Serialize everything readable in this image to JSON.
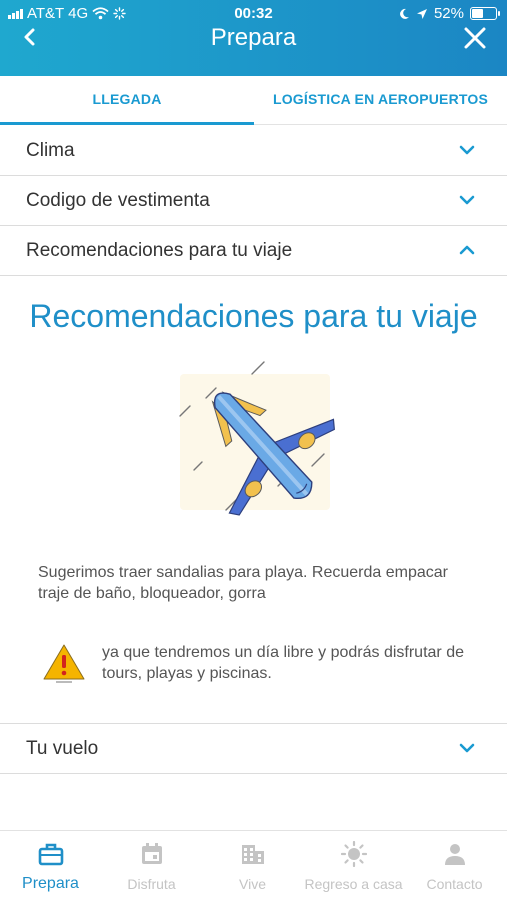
{
  "status_bar": {
    "carrier": "AT&T 4G",
    "time": "00:32",
    "battery": "52%",
    "battery_level": 0.52
  },
  "header": {
    "title": "Prepara"
  },
  "tabs": [
    {
      "label": "LLEGADA",
      "active": true
    },
    {
      "label": "LOGÍSTICA EN AEROPUERTOS",
      "active": false
    }
  ],
  "accordion": {
    "clima": "Clima",
    "vestimenta": "Codigo de vestimenta",
    "recomendaciones": "Recomendaciones para tu viaje",
    "vuelo": "Tu vuelo"
  },
  "section": {
    "title": "Recomendaciones para tu viaje",
    "paragraph": "Sugerimos traer sandalias para playa. Recuerda empacar traje de baño, bloqueador, gorra",
    "warning": "ya que tendremos un día libre y podrás disfrutar de tours, playas y piscinas."
  },
  "bottom_nav": [
    {
      "label": "Prepara",
      "icon": "briefcase-icon",
      "active": true
    },
    {
      "label": "Disfruta",
      "icon": "calendar-icon",
      "active": false
    },
    {
      "label": "Vive",
      "icon": "building-icon",
      "active": false
    },
    {
      "label": "Regreso a casa",
      "icon": "sun-icon",
      "active": false
    },
    {
      "label": "Contacto",
      "icon": "person-icon",
      "active": false
    }
  ],
  "colors": {
    "header_start": "#1fa8cf",
    "header_end": "#1b86c4",
    "accent": "#1a9ad1",
    "inactive": "#c4c4c4"
  }
}
